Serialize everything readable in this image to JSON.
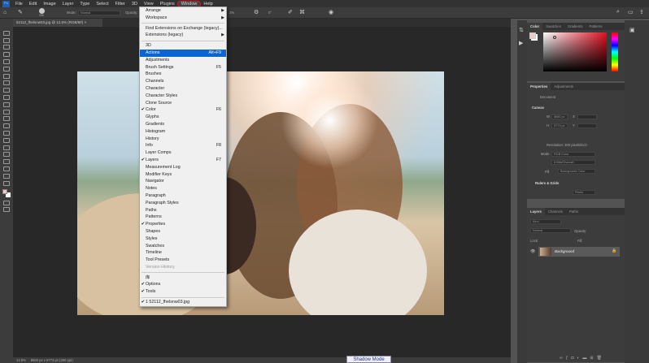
{
  "menubar": {
    "logo": "Ps",
    "items": [
      "File",
      "Edit",
      "Image",
      "Layer",
      "Type",
      "Select",
      "Filter",
      "3D",
      "View",
      "Plugins",
      "Window",
      "Help"
    ],
    "active": "Window"
  },
  "options": {
    "brush_size": "358",
    "mode_label": "Mode:",
    "mode_value": "Normal",
    "opacity_label": "Opacity:",
    "flow_label": "Flow:",
    "flow_value": "3%",
    "angle_value": "0°"
  },
  "document_tab": {
    "title": "52112_fhelsnw03.jpg @ 12.5% (RGB/8#)",
    "close": "×"
  },
  "window_menu": {
    "groups": [
      [
        {
          "label": "Arrange",
          "submenu": true
        },
        {
          "label": "Workspace",
          "submenu": true
        }
      ],
      [
        {
          "label": "Find Extensions on Exchange (legacy)..."
        },
        {
          "label": "Extensions (legacy)",
          "submenu": true
        }
      ],
      [
        {
          "label": "3D"
        },
        {
          "label": "Actions",
          "shortcut": "Alt+F9",
          "highlighted": true
        },
        {
          "label": "Adjustments"
        },
        {
          "label": "Brush Settings",
          "shortcut": "F5"
        },
        {
          "label": "Brushes"
        },
        {
          "label": "Channels"
        },
        {
          "label": "Character"
        },
        {
          "label": "Character Styles"
        },
        {
          "label": "Clone Source"
        },
        {
          "label": "Color",
          "shortcut": "F6",
          "checked": true
        },
        {
          "label": "Glyphs"
        },
        {
          "label": "Gradients"
        },
        {
          "label": "Histogram"
        },
        {
          "label": "History"
        },
        {
          "label": "Info",
          "shortcut": "F8"
        },
        {
          "label": "Layer Comps"
        },
        {
          "label": "Layers",
          "shortcut": "F7",
          "checked": true
        },
        {
          "label": "Measurement Log"
        },
        {
          "label": "Modifier Keys"
        },
        {
          "label": "Navigator"
        },
        {
          "label": "Notes"
        },
        {
          "label": "Paragraph"
        },
        {
          "label": "Paragraph Styles"
        },
        {
          "label": "Paths"
        },
        {
          "label": "Patterns"
        },
        {
          "label": "Properties",
          "checked": true
        },
        {
          "label": "Shapes"
        },
        {
          "label": "Styles"
        },
        {
          "label": "Swatches"
        },
        {
          "label": "Timeline"
        },
        {
          "label": "Tool Presets"
        },
        {
          "label": "Version History",
          "disabled": true
        }
      ],
      [
        {
          "label": "库"
        },
        {
          "label": "Options",
          "checked": true
        },
        {
          "label": "Tools",
          "checked": true
        }
      ],
      [
        {
          "label": "1 52112_fhelsnw03.jpg",
          "checked": true
        }
      ]
    ]
  },
  "color_panel": {
    "tabs": [
      "Color",
      "Swatches",
      "Gradients",
      "Patterns"
    ],
    "active": "Color",
    "foreground": "#f0c8cc",
    "hue": "#e01020"
  },
  "properties_panel": {
    "tabs": [
      "Properties",
      "Adjustments"
    ],
    "active": "Properties",
    "kind": "Document",
    "canvas_heading": "Canvas",
    "w_label": "W",
    "w_value": "8660 px",
    "h_label": "H",
    "h_value": "5773 px",
    "x_label": "X",
    "y_label": "Y",
    "resolution": "Resolution: 300 pixels/inch",
    "mode_label": "Mode",
    "mode_value": "RGB Color",
    "depth_value": "8 Bits/Channel",
    "fill_label": "Fill",
    "fill_value": "Background Color",
    "rulers_heading": "Rulers & Grids",
    "units": "Pixels"
  },
  "layers_panel": {
    "tabs": [
      "Layers",
      "Channels",
      "Paths"
    ],
    "active": "Layers",
    "search": "Kind",
    "blend": "Normal",
    "opacity_label": "Opacity:",
    "lock_label": "Lock:",
    "fill_label": "Fill:",
    "layers": [
      {
        "name": "Background",
        "visible": true,
        "locked": true
      }
    ]
  },
  "status": {
    "zoom": "12.5%",
    "size": "8660 px x 5773 px (300 ppi)"
  },
  "shadow_mode": "Shadow Mode"
}
